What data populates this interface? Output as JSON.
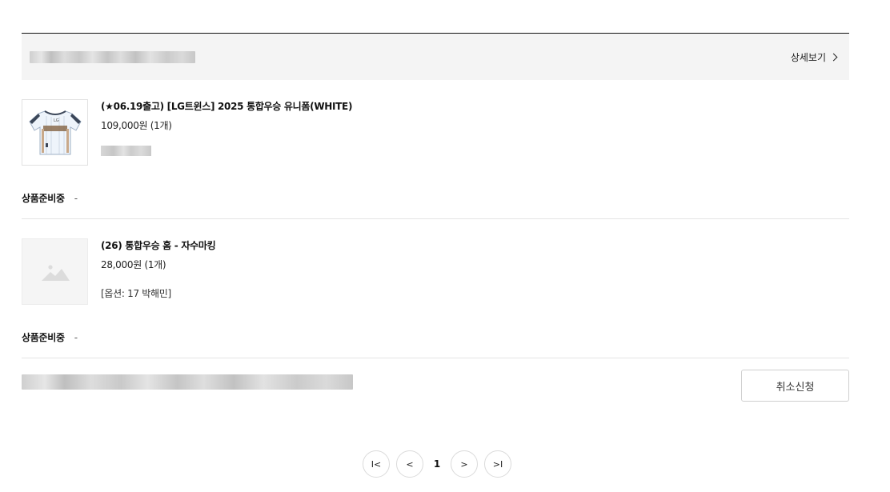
{
  "order": {
    "detail_link": "상세보기",
    "items": [
      {
        "name": "(★06.19출고) [LG트윈스] 2025 통합우승 유니폼(WHITE)",
        "price": "109,000원 (1개)",
        "option": "",
        "status_label": "상품준비중",
        "status_value": "-",
        "thumb_icon": "jersey-image"
      },
      {
        "name": "(26) 통합우승 홈 - 자수마킹",
        "price": "28,000원 (1개)",
        "option": "[옵션: 17 박해민]",
        "status_label": "상품준비중",
        "status_value": "-",
        "thumb_icon": "image-placeholder-icon"
      }
    ],
    "cancel_button": "취소신청"
  },
  "pagination": {
    "first": "I<",
    "prev": "<",
    "current": "1",
    "next": ">",
    "last": ">I"
  },
  "colors": {
    "header_bg": "#f4f4f4",
    "divider": "#e4e4e4",
    "text": "#111111"
  }
}
